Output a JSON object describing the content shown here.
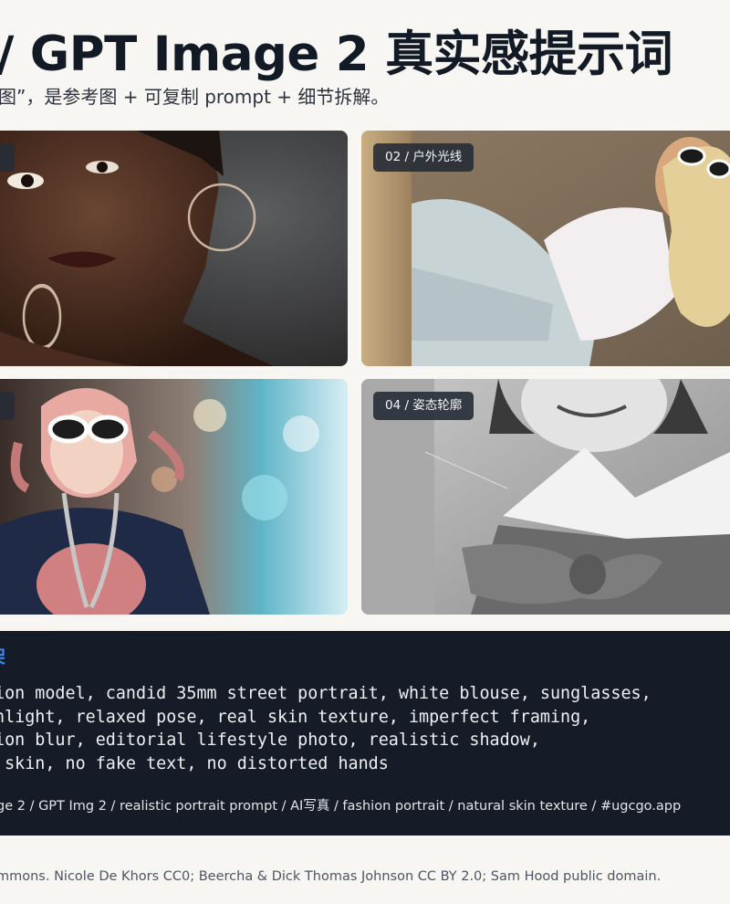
{
  "header": {
    "title": "/ GPT Image 2 真实感提示词",
    "subtitle": "图”，是参考图  +  可复制 prompt  + 细节拆解。"
  },
  "gallery": {
    "cards": [
      {
        "label": "",
        "photo": "portrait-woman-hoop-earrings"
      },
      {
        "label": "02 / 户外光线",
        "photo": "woman-sunglasses-lying-outdoors"
      },
      {
        "label": "",
        "photo": "street-portrait-white-sunglasses-pigtails"
      },
      {
        "label": "04 / 姿态轮廓",
        "photo": "vintage-bw-woman-bow-collar"
      }
    ]
  },
  "prompt_panel": {
    "heading": "架",
    "lines": [
      "ion model, candid 35mm street portrait, white blouse, sunglasses,",
      "nlight, relaxed pose, real skin texture, imperfect framing,",
      "ion blur, editorial lifestyle photo, realistic shadow,",
      " skin, no fake text, no distorted hands"
    ],
    "tags": "ge 2 / GPT Img 2 / realistic portrait prompt / AI写真 / fashion portrait / natural skin texture / #ugcgo.app"
  },
  "footer": {
    "credits": "mmons. Nicole De Khors CC0; Beercha & Dick Thomas Johnson CC BY 2.0; Sam Hood public domain."
  },
  "colors": {
    "background": "#f7f6f2",
    "panel": "#151c28",
    "accent": "#3f85f2",
    "badge": "#262c36"
  }
}
